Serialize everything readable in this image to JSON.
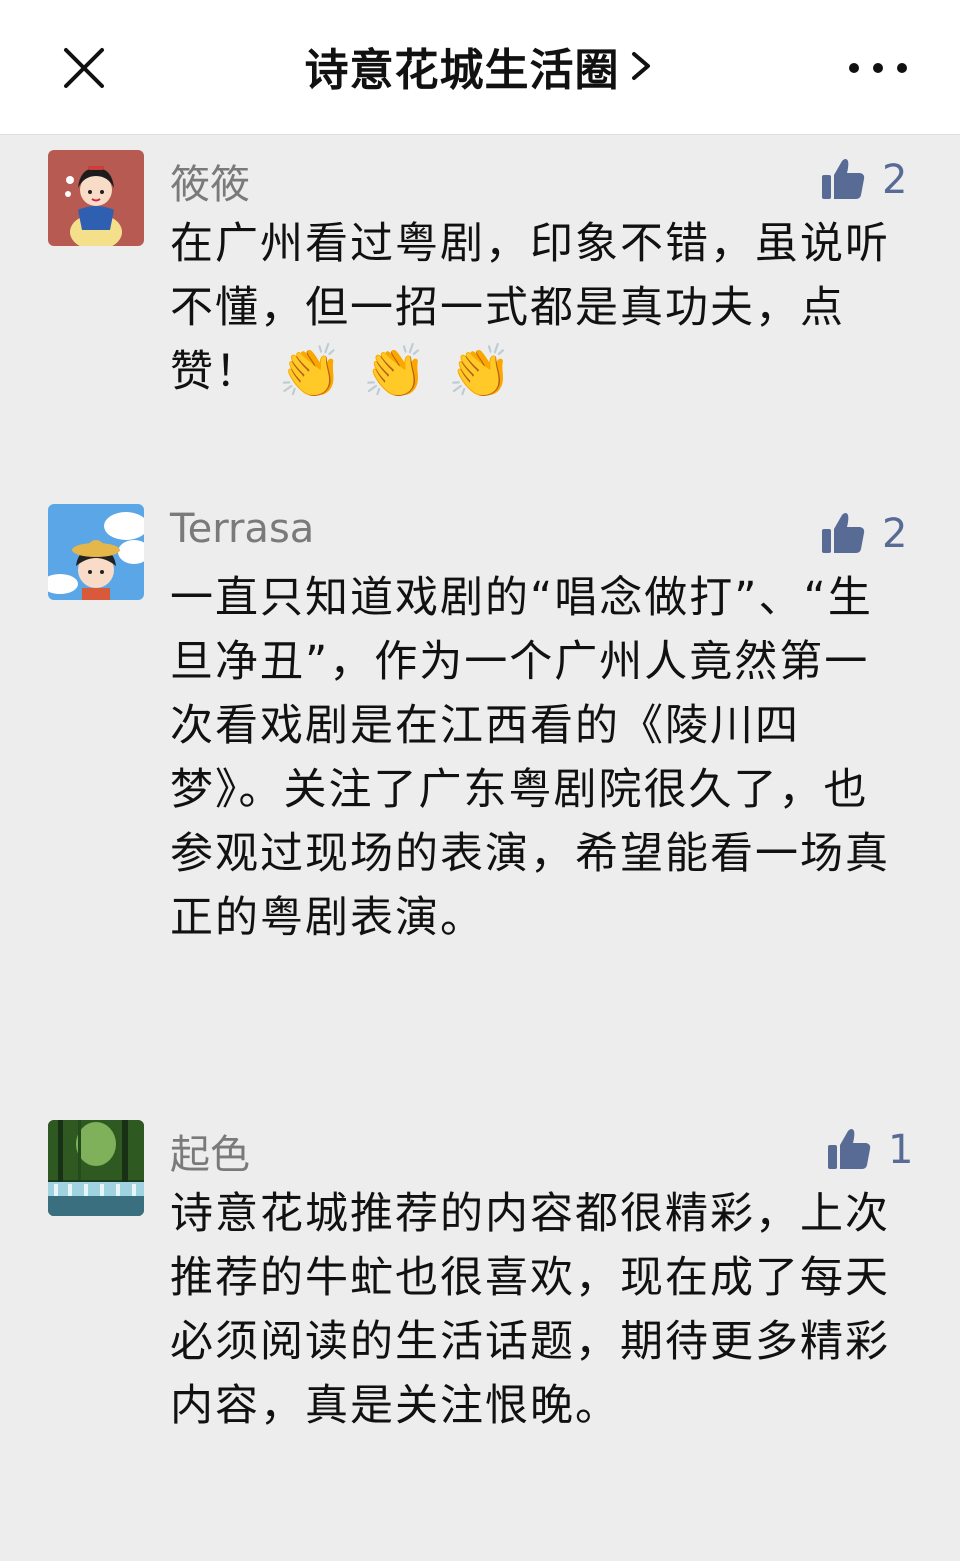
{
  "header": {
    "title": "诗意花城生活圈",
    "chevron_icon": "chevron-right-icon",
    "close_icon": "close-icon",
    "more_icon": "more-icon"
  },
  "colors": {
    "link_blue": "#576b95",
    "username_gray": "#7a7a7a",
    "background": "#ededed"
  },
  "comments": [
    {
      "username": "筱筱",
      "avatar": "snow-white-cartoon-avatar",
      "likes": "2",
      "text": "在广州看过粤剧，印象不错，虽说听不懂，但一招一式都是真功夫，点赞！",
      "emojis": [
        "👏",
        "👏",
        "👏"
      ]
    },
    {
      "username": "Terrasa",
      "avatar": "chibi-maruko-sky-avatar",
      "likes": "2",
      "text": "一直只知道戏剧的“唱念做打”、“生旦净丑”，作为一个广州人竟然第一次看戏剧是在江西看的《陵川四梦》。关注了广东粤剧院很久了，也参观过现场的表演，希望能看一场真正的粤剧表演。"
    },
    {
      "username": "起色",
      "avatar": "forest-waterfall-avatar",
      "likes": "1",
      "text": "诗意花城推荐的内容都很精彩，上次推荐的牛虻也很喜欢，现在成了每天必须阅读的生活话题，期待更多精彩内容，真是关注恨晚。"
    }
  ]
}
